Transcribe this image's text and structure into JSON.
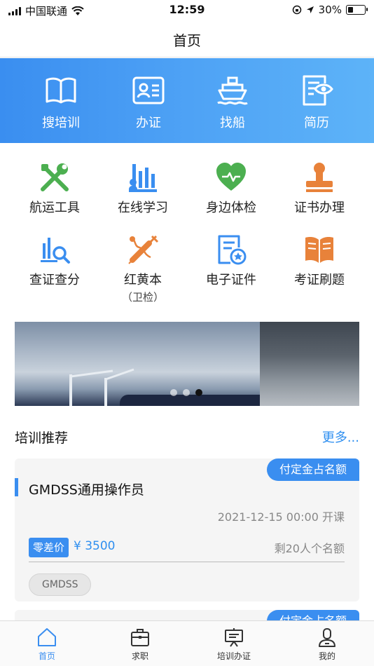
{
  "status_bar": {
    "carrier": "中国联通",
    "time": "12:59",
    "battery": "30%",
    "battery_level": 0.3
  },
  "nav": {
    "title": "首页"
  },
  "hero": {
    "items": [
      {
        "label": "搜培训",
        "icon": "book-icon"
      },
      {
        "label": "办证",
        "icon": "id-card-icon"
      },
      {
        "label": "找船",
        "icon": "ship-icon"
      },
      {
        "label": "简历",
        "icon": "resume-icon"
      }
    ]
  },
  "grid": {
    "items": [
      {
        "label": "航运工具",
        "icon": "tools-icon",
        "color": "#4caf50"
      },
      {
        "label": "在线学习",
        "icon": "study-icon",
        "color": "#3a8ef0"
      },
      {
        "label": "身边体检",
        "icon": "heart-icon",
        "color": "#4caf50"
      },
      {
        "label": "证书办理",
        "icon": "stamp-icon",
        "color": "#e8823a"
      },
      {
        "label": "查证查分",
        "icon": "chart-search-icon",
        "color": "#3a8ef0"
      },
      {
        "label": "红黄本",
        "sub": "（卫检）",
        "icon": "syringe-icon",
        "color": "#e8823a"
      },
      {
        "label": "电子证件",
        "icon": "e-certificate-icon",
        "color": "#3a8ef0"
      },
      {
        "label": "考证刷题",
        "icon": "open-book-icon",
        "color": "#e8823a"
      }
    ]
  },
  "carousel": {
    "dot_count": 3,
    "active_dot": 2
  },
  "training": {
    "title": "培训推荐",
    "more": "更多...",
    "cards": [
      {
        "tag": "付定金占名额",
        "title": "GMDSS通用操作员",
        "time": "2021-12-15 00:00 开课",
        "price_badge": "零差价",
        "price": "¥ 3500",
        "seats": "剩20人个名额",
        "chip": "GMDSS"
      }
    ]
  },
  "tab_bar": {
    "tabs": [
      {
        "label": "首页",
        "icon": "home-icon",
        "active": true
      },
      {
        "label": "求职",
        "icon": "briefcase-icon",
        "active": false
      },
      {
        "label": "培训办证",
        "icon": "presentation-icon",
        "active": false
      },
      {
        "label": "我的",
        "icon": "user-icon",
        "active": false
      }
    ]
  },
  "colors": {
    "accent": "#3a8ef0",
    "link": "#2f8ff0"
  }
}
